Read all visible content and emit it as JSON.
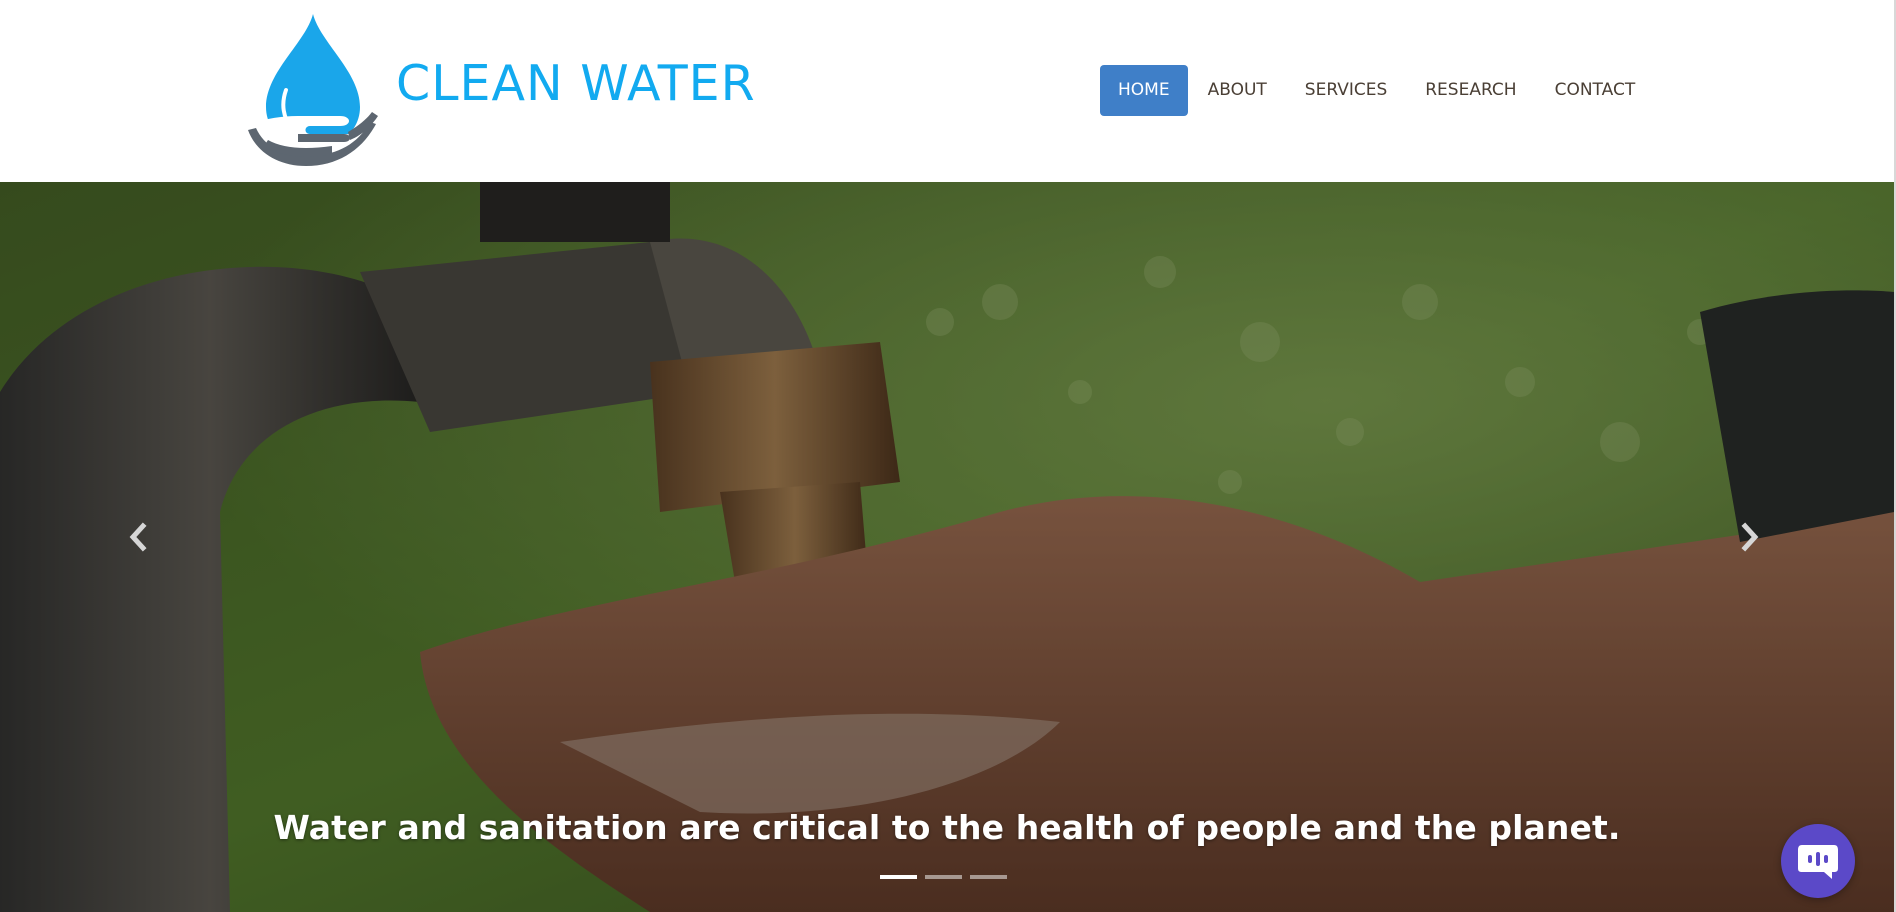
{
  "brand": {
    "name": "CLEAN WATER",
    "logo_icon": "water-drop-in-hand-icon",
    "color": "#12aaf0"
  },
  "nav": {
    "accent_color": "#3f7fc8",
    "items": [
      {
        "label": "HOME",
        "active": true
      },
      {
        "label": "ABOUT",
        "active": false
      },
      {
        "label": "SERVICES",
        "active": false
      },
      {
        "label": "RESEARCH",
        "active": false
      },
      {
        "label": "CONTACT",
        "active": false
      }
    ]
  },
  "hero": {
    "caption": "Water and sanitation are critical to the health of people and the planet.",
    "image": "hands-under-water-tap-photo",
    "prev_icon": "chevron-left-icon",
    "next_icon": "chevron-right-icon",
    "slide_count": 3,
    "active_slide": 1
  },
  "chat_widget": {
    "icon": "chat-bubble-icon",
    "color": "#5b49c8"
  }
}
